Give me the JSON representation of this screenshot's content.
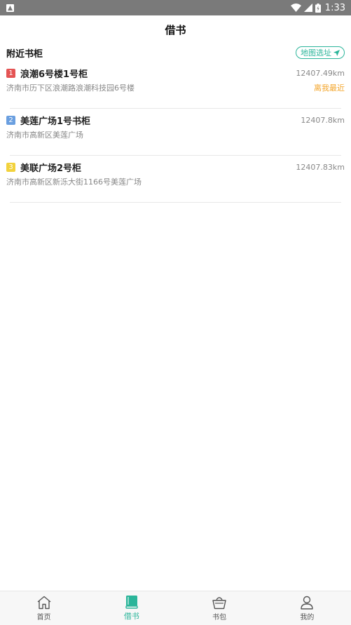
{
  "status_bar": {
    "time": "1:33"
  },
  "header": {
    "title": "借书"
  },
  "section": {
    "title": "附近书柜",
    "map_button_label": "地图选址"
  },
  "cabinets": [
    {
      "index": "1",
      "name": "浪潮6号楼1号柜",
      "distance": "12407.49km",
      "address": "济南市历下区浪潮路浪潮科技园6号楼",
      "tag": "离我最近",
      "badge_color": "#e45454"
    },
    {
      "index": "2",
      "name": "美莲广场1号书柜",
      "distance": "12407.8km",
      "address": "济南市高新区美莲广场",
      "tag": "",
      "badge_color": "#6a9fe0"
    },
    {
      "index": "3",
      "name": "美联广场2号柜",
      "distance": "12407.83km",
      "address": "济南市高新区新泺大街1166号美莲广场",
      "tag": "",
      "badge_color": "#f2d23c"
    }
  ],
  "tab_bar": {
    "tabs": [
      {
        "label": "首页",
        "icon": "home-icon"
      },
      {
        "label": "借书",
        "icon": "book-icon"
      },
      {
        "label": "书包",
        "icon": "basket-icon"
      },
      {
        "label": "我的",
        "icon": "person-icon"
      }
    ],
    "active_index": 1
  },
  "colors": {
    "accent": "#2bb59a",
    "tag": "#f3a52b"
  }
}
